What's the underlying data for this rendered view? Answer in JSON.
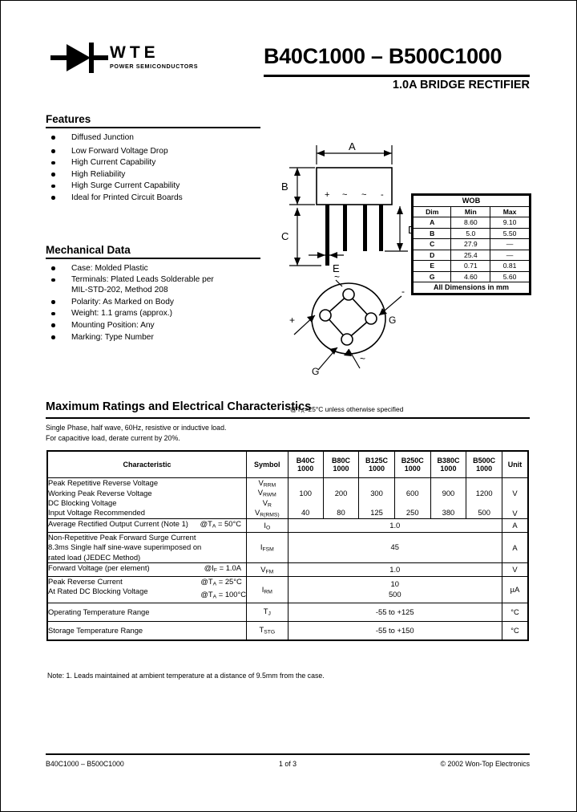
{
  "header": {
    "logo_text": "WTE",
    "logo_sub": "POWER SEMICONDUCTORS",
    "logo_icon": "diode-symbol-icon",
    "title": "B40C1000 – B500C1000",
    "subtitle": "1.0A BRIDGE RECTIFIER"
  },
  "features": {
    "title": "Features",
    "items": [
      "Diffused Junction",
      "Low Forward Voltage Drop",
      "High Current Capability",
      "High Reliability",
      "High Surge Current Capability",
      "Ideal for Printed Circuit Boards"
    ]
  },
  "mechanical": {
    "title": "Mechanical Data",
    "items": [
      "Case: Molded Plastic",
      "Terminals: Plated Leads Solderable per",
      "Polarity: As Marked on Body",
      "Weight: 1.1 grams (approx.)",
      "Mounting Position: Any",
      "Marking: Type Number"
    ],
    "terminals_line2": "MIL-STD-202, Method 208"
  },
  "drawing": {
    "dim_labels": [
      "A",
      "B",
      "C",
      "D",
      "E",
      "G"
    ],
    "body_markings": [
      "+",
      "~",
      "~",
      "–"
    ],
    "bottom_view_markings": [
      "~",
      "–",
      "G",
      "G",
      "~",
      "+"
    ]
  },
  "wob": {
    "package_name": "WOB",
    "columns": [
      "Dim",
      "Min",
      "Max"
    ],
    "rows": [
      {
        "dim": "A",
        "min": "8.60",
        "max": "9.10"
      },
      {
        "dim": "B",
        "min": "5.0",
        "max": "5.50"
      },
      {
        "dim": "C",
        "min": "27.9",
        "max": "—"
      },
      {
        "dim": "D",
        "min": "25.4",
        "max": "—"
      },
      {
        "dim": "E",
        "min": "0.71",
        "max": "0.81"
      },
      {
        "dim": "G",
        "min": "4.60",
        "max": "5.60"
      }
    ],
    "footer": "All Dimensions in mm"
  },
  "ratings": {
    "title": "Maximum Ratings and Electrical Characteristics",
    "condition": "@TA=25°C unless otherwise specified",
    "note_line1": "Single Phase, half wave, 60Hz, resistive or inductive load.",
    "note_line2": "For capacitive load, derate current by 20%.",
    "columns": [
      "Characteristic",
      "Symbol",
      "B40C 1000",
      "B80C 1000",
      "B125C 1000",
      "B250C 1000",
      "B380C 1000",
      "B500C 1000",
      "Unit"
    ],
    "rows": [
      {
        "characteristic_lines": [
          "Peak Repetitive Reverse Voltage",
          "Working Peak Reverse Voltage",
          "DC Blocking Voltage"
        ],
        "symbol_lines": [
          "VRRM",
          "VRWM",
          "VR"
        ],
        "values": [
          "100",
          "200",
          "300",
          "600",
          "900",
          "1200"
        ],
        "unit": "V"
      },
      {
        "characteristic_lines": [
          "Input Voltage Recommended"
        ],
        "symbol_lines": [
          "VR(RMS)"
        ],
        "values": [
          "40",
          "80",
          "125",
          "250",
          "380",
          "500"
        ],
        "unit": "V"
      },
      {
        "characteristic_lines": [
          "Average Rectified Output Current (Note 1)"
        ],
        "condition": "@TA = 50°C",
        "symbol_lines": [
          "IO"
        ],
        "span_value": "1.0",
        "unit": "A"
      },
      {
        "characteristic_lines": [
          "Non-Repetitive Peak Forward Surge Current",
          "8.3ms Single half sine-wave superimposed on",
          "rated load (JEDEC Method)"
        ],
        "symbol_lines": [
          "IFSM"
        ],
        "span_value": "45",
        "unit": "A"
      },
      {
        "characteristic_lines": [
          "Forward Voltage (per element)"
        ],
        "condition": "@IF = 1.0A",
        "symbol_lines": [
          "VFM"
        ],
        "span_value": "1.0",
        "unit": "V"
      },
      {
        "characteristic_lines": [
          "Peak Reverse Current",
          "At Rated DC Blocking Voltage"
        ],
        "condition_lines": [
          "@TA = 25°C",
          "@TA = 100°C"
        ],
        "symbol_lines": [
          "IRM"
        ],
        "span_value_lines": [
          "10",
          "500"
        ],
        "unit": "µA"
      },
      {
        "characteristic_lines": [
          "Operating Temperature Range"
        ],
        "symbol_lines": [
          "TJ"
        ],
        "span_value": "-55 to +125",
        "unit": "°C"
      },
      {
        "characteristic_lines": [
          "Storage Temperature Range"
        ],
        "symbol_lines": [
          "TSTG"
        ],
        "span_value": "-55 to +150",
        "unit": "°C"
      }
    ]
  },
  "note": "Note:  1. Leads maintained at ambient temperature at a distance of 9.5mm from the case.",
  "footer": {
    "left": "B40C1000 – B500C1000",
    "center": "1 of 3",
    "right": "© 2002 Won-Top Electronics"
  }
}
